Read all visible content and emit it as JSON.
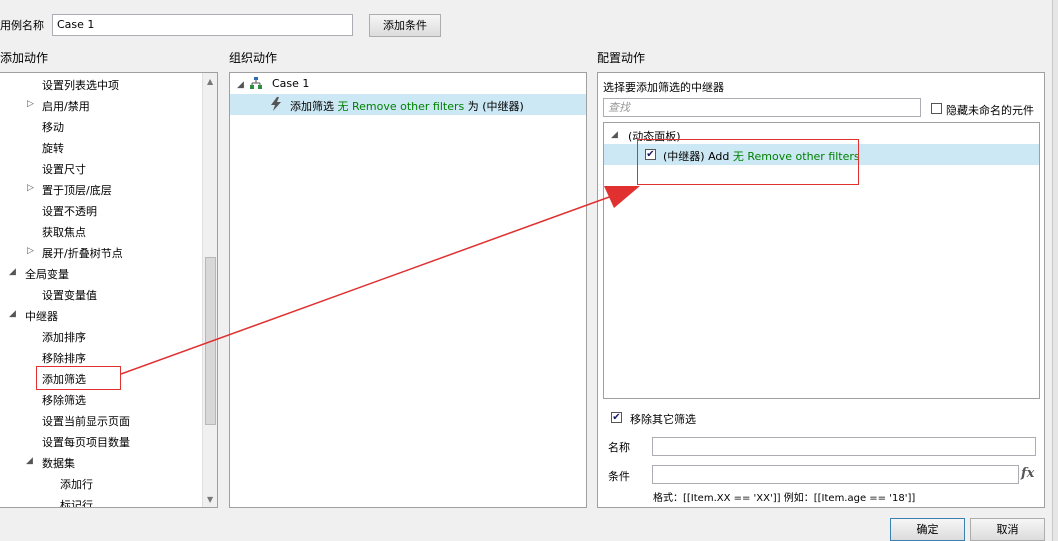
{
  "header": {
    "case_name_label": "用例名称",
    "case_name_value": "Case 1",
    "add_condition_button": "添加条件"
  },
  "left": {
    "title": "添加动作",
    "items": [
      {
        "label": "设置列表选中项"
      },
      {
        "label": "启用/禁用"
      },
      {
        "label": "移动"
      },
      {
        "label": "旋转"
      },
      {
        "label": "设置尺寸"
      },
      {
        "label": "置于顶层/底层"
      },
      {
        "label": "设置不透明"
      },
      {
        "label": "获取焦点"
      },
      {
        "label": "展开/折叠树节点"
      },
      {
        "label": "全局变量"
      },
      {
        "label": "设置变量值"
      },
      {
        "label": "中继器"
      },
      {
        "label": "添加排序"
      },
      {
        "label": "移除排序"
      },
      {
        "label": "添加筛选"
      },
      {
        "label": "移除筛选"
      },
      {
        "label": "设置当前显示页面"
      },
      {
        "label": "设置每页项目数量"
      },
      {
        "label": "数据集"
      },
      {
        "label": "添加行"
      },
      {
        "label": "标记行"
      }
    ]
  },
  "middle": {
    "title": "组织动作",
    "case_label": "Case 1",
    "action_prefix": "添加筛选",
    "action_green": "无 Remove other filters",
    "action_suffix": "为 (中继器)"
  },
  "right": {
    "title": "配置动作",
    "subtitle": "选择要添加筛选的中继器",
    "search_placeholder": "查找",
    "hide_unnamed_label": "隐藏未命名的元件",
    "group_label": "(动态面板)",
    "repeater_prefix": "(中继器) Add",
    "repeater_green": "无 Remove other filters",
    "remove_other_filters_label": "移除其它筛选",
    "name_label": "名称",
    "condition_label": "条件",
    "fx_label": "fx",
    "format_hint": "格式：[[Item.XX == 'XX']] 例如：[[Item.age == '18']]"
  },
  "footer": {
    "ok_button": "确定",
    "cancel_button": "取消"
  },
  "colors": {
    "selection": "#cce8f4",
    "annotation_red": "#e03030",
    "green_text": "#008000"
  }
}
